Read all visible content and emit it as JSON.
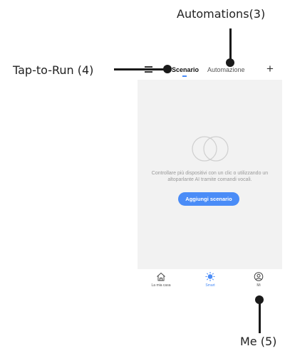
{
  "header": {
    "tabs": [
      {
        "label": "Scenario",
        "active": true
      },
      {
        "label": "Automazione",
        "active": false
      }
    ]
  },
  "empty_state": {
    "message": "Controllare più dispositivi con un clic o utilizzando un altoparlante AI tramite comandi vocali.",
    "button_label": "Aggiungi scenario"
  },
  "bottom_nav": {
    "items": [
      {
        "label": "La mia casa",
        "icon": "home-icon",
        "active": false
      },
      {
        "label": "Smart",
        "icon": "smart-sun-icon",
        "active": true
      },
      {
        "label": "Mi",
        "icon": "profile-icon",
        "active": false
      }
    ]
  },
  "callouts": {
    "tap_to_run": "Tap-to-Run (4)",
    "automations": "Automations(3)",
    "me": "Me (5)"
  },
  "colors": {
    "accent": "#4a8cf7",
    "content_bg": "#f2f2f2",
    "annotation": "#1a1a1a"
  }
}
